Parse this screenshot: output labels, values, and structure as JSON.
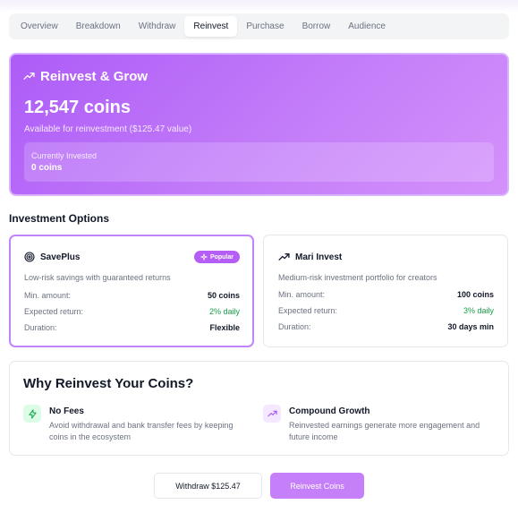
{
  "tabs": [
    {
      "label": "Overview"
    },
    {
      "label": "Breakdown"
    },
    {
      "label": "Withdraw"
    },
    {
      "label": "Reinvest",
      "active": true
    },
    {
      "label": "Purchase"
    },
    {
      "label": "Borrow"
    },
    {
      "label": "Audience"
    }
  ],
  "hero": {
    "icon": "trending-up-icon",
    "title": "Reinvest & Grow",
    "coins": "12,547 coins",
    "subtitle": "Available for reinvestment ($125.47 value)",
    "invested_label": "Currently Invested",
    "invested_value": "0 coins"
  },
  "investment_section": {
    "title": "Investment Options"
  },
  "options": [
    {
      "icon": "target-icon",
      "name": "SavePlus",
      "badge": "Popular",
      "badge_icon": "sparkle-icon",
      "description": "Low-risk savings with guaranteed returns",
      "min_label": "Min. amount:",
      "min_value": "50 coins",
      "return_label": "Expected return:",
      "return_value": "2% daily",
      "duration_label": "Duration:",
      "duration_value": "Flexible",
      "selected": true
    },
    {
      "icon": "trending-up-icon",
      "name": "Mari Invest",
      "description": "Medium-risk investment portfolio for creators",
      "min_label": "Min. amount:",
      "min_value": "100 coins",
      "return_label": "Expected return:",
      "return_value": "3% daily",
      "duration_label": "Duration:",
      "duration_value": "30 days min",
      "selected": false
    }
  ],
  "why": {
    "title": "Why Reinvest Your Coins?",
    "benefits": [
      {
        "icon": "lightning-icon",
        "title": "No Fees",
        "text": "Avoid withdrawal and bank transfer fees by keeping coins in the ecosystem"
      },
      {
        "icon": "trending-up-icon",
        "title": "Compound Growth",
        "text": "Reinvested earnings generate more engagement and future income"
      }
    ]
  },
  "actions": {
    "withdraw_label": "Withdraw $125.47",
    "reinvest_label": "Reinvest Coins"
  },
  "colors": {
    "accent": "#b45ef6",
    "hero_gradient_start": "#ad5cf7",
    "hero_gradient_end": "#d491fb",
    "positive": "#16a34a"
  }
}
